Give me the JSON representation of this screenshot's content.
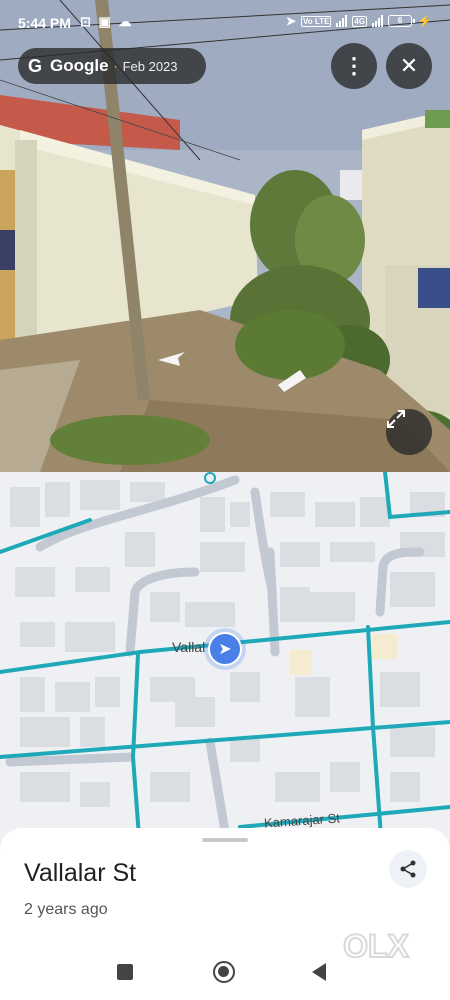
{
  "status_bar": {
    "time": "5:44 PM",
    "left_icons": "⊡ ▣ ☁",
    "right_icons": [
      "location-arrow",
      "volte-signal",
      "signal",
      "4g-signal",
      "battery"
    ],
    "volte": "Vo LTE",
    "network": "4G",
    "battery_level": "6"
  },
  "street_view": {
    "provider_label": "Google",
    "separator": "·",
    "capture_date": "Feb 2023",
    "buttons": {
      "more_icon": "more-vertical-icon",
      "close_icon": "close-icon",
      "expand_icon": "expand-icon"
    }
  },
  "map": {
    "street_labels": {
      "vallalar": "Vallal",
      "kamarajar": "Kamarajar St"
    },
    "road_color": "#1fa8b8",
    "marker_color": "#4a7fe8"
  },
  "sheet": {
    "title": "Vallalar St",
    "subtitle": "2 years ago",
    "share_icon": "share-icon"
  },
  "watermark": "OLX",
  "nav": {
    "recent_icon": "square-icon",
    "home_icon": "circle-icon",
    "back_icon": "triangle-back-icon"
  }
}
